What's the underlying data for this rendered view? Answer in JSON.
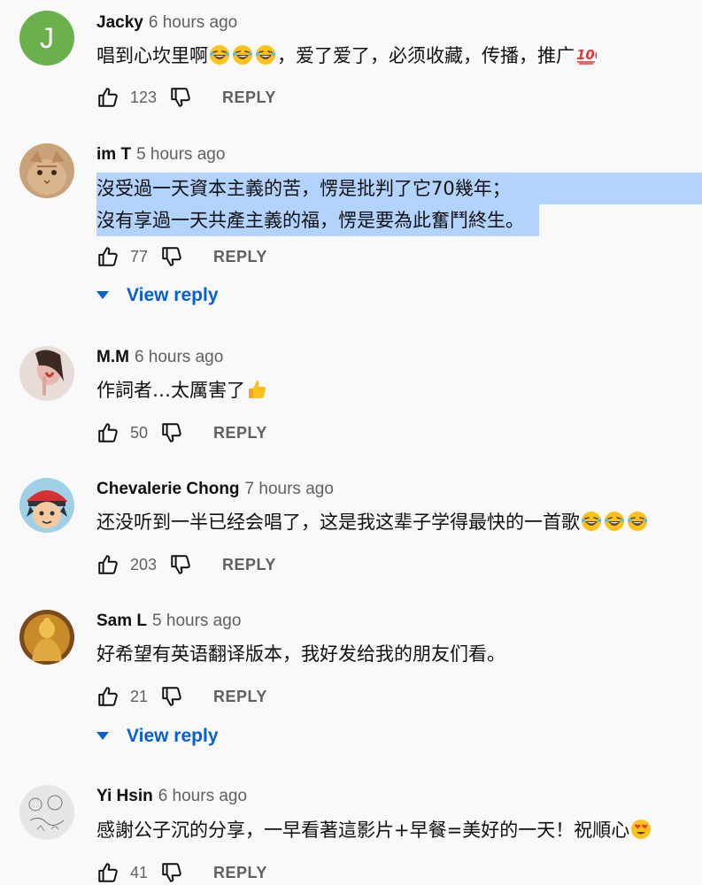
{
  "comments": [
    {
      "author": "Jacky",
      "time": "6 hours ago",
      "avatar_letter": "J",
      "text_lines": [
        "唱到心坎里啊",
        "，爱了爱了，必须收藏，传播，推广"
      ],
      "likes": "123",
      "reply_label": "REPLY"
    },
    {
      "author": "im T",
      "time": "5 hours ago",
      "text_lines": [
        "沒受過一天資本主義的苦，愣是批判了它70幾年；",
        "沒有享過一天共產主義的福，愣是要為此奮鬥終生。"
      ],
      "likes": "77",
      "reply_label": "REPLY",
      "view_reply": "View reply"
    },
    {
      "author": "M.M",
      "time": "6 hours ago",
      "text_lines": [
        "作詞者…太厲害了"
      ],
      "likes": "50",
      "reply_label": "REPLY"
    },
    {
      "author": "Chevalerie Chong",
      "time": "7 hours ago",
      "text_lines": [
        "还没听到一半已经会唱了，这是我这辈子学得最快的一首歌"
      ],
      "likes": "203",
      "reply_label": "REPLY"
    },
    {
      "author": "Sam L",
      "time": "5 hours ago",
      "text_lines": [
        "好希望有英语翻译版本，我好发给我的朋友们看。"
      ],
      "likes": "21",
      "reply_label": "REPLY",
      "view_reply": "View reply"
    },
    {
      "author": "Yi Hsin",
      "time": "6 hours ago",
      "text_lines": [
        "感謝公子沉的分享，一早看著這影片+早餐=美好的一天！祝順心"
      ],
      "likes": "41",
      "reply_label": "REPLY"
    }
  ],
  "icons": {
    "like": "thumbs-up-icon",
    "dislike": "thumbs-down-icon",
    "caret": "caret-down-icon",
    "emoji_laugh": "rolling-on-floor-laughing-emoji",
    "emoji_100": "hundred-points-emoji",
    "emoji_thumb": "thumbs-up-emoji",
    "emoji_heart_eyes": "heart-eyes-emoji"
  },
  "colors": {
    "background": "#f9f9f9",
    "link": "#065fd4",
    "secondary_text": "#606060",
    "selection": "#b3d3ff",
    "avatar_j": "#6ab04c"
  }
}
